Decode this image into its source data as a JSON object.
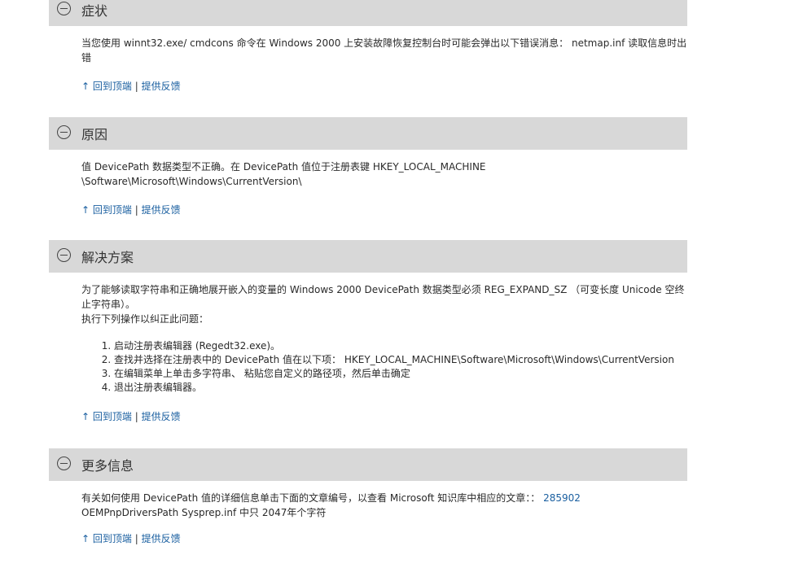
{
  "common": {
    "back_to_top": "↑ 回到顶端",
    "separator": "|",
    "feedback": "提供反馈"
  },
  "sections": [
    {
      "title": "症状",
      "body": "当您使用 winnt32.exe/ cmdcons 命令在 Windows 2000 上安装故障恢复控制台时可能会弹出以下错误消息： netmap.inf 读取信息时出错"
    },
    {
      "title": "原因",
      "body_line1": "值 DevicePath 数据类型不正确。在 DevicePath 值位于注册表键 HKEY_LOCAL_MACHINE",
      "body_line2": "\\Software\\Microsoft\\Windows\\CurrentVersion\\"
    },
    {
      "title": "解决方案",
      "intro": "为了能够读取字符串和正确地展开嵌入的变量的 Windows 2000 DevicePath 数据类型必须 REG_EXPAND_SZ （可变长度 Unicode 空终止字符串）。",
      "intro2": "执行下列操作以纠正此问题：",
      "steps": [
        "启动注册表编辑器 (Regedt32.exe)。",
        "查找并选择在注册表中的 DevicePath 值在以下项： HKEY_LOCAL_MACHINE\\Software\\Microsoft\\Windows\\CurrentVersion",
        "在编辑菜单上单击多字符串、 粘贴您自定义的路径项，然后单击确定",
        "退出注册表编辑器。"
      ]
    },
    {
      "title": "更多信息",
      "body_prefix": "有关如何使用 DevicePath 值的详细信息单击下面的文章编号，以查看 Microsoft 知识库中相应的文章：：",
      "article_link": "285902",
      "body_line2": "OEMPnpDriversPath Sysprep.inf 中只 2047年个字符"
    }
  ]
}
